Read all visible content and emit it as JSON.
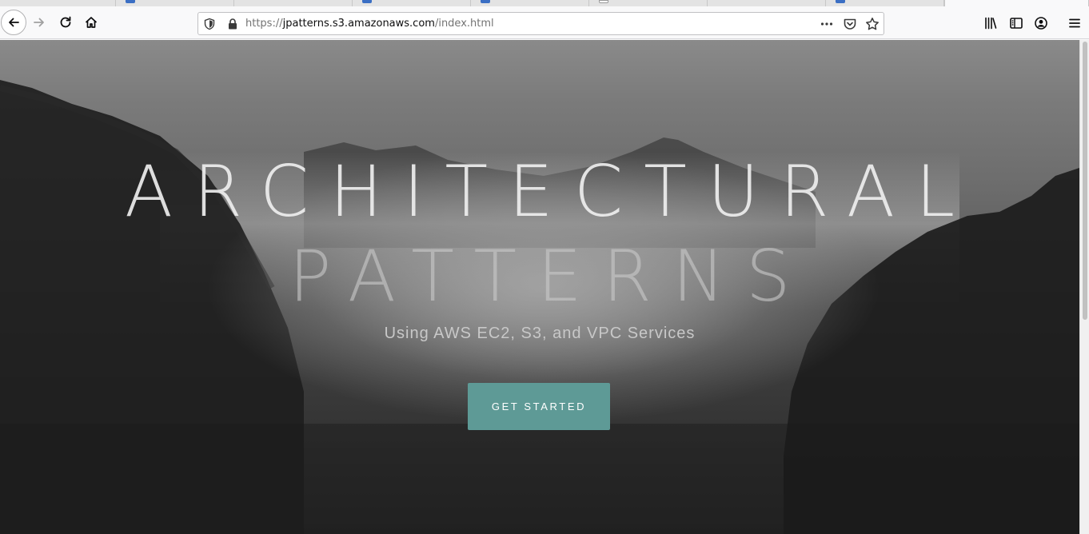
{
  "browser": {
    "tabs": [
      {
        "label": "",
        "active": false
      },
      {
        "label": "",
        "active": false
      },
      {
        "label": "",
        "active": false
      },
      {
        "label": "",
        "active": false
      },
      {
        "label": "",
        "active": false
      },
      {
        "label": "",
        "active": false
      },
      {
        "label": "",
        "active": false
      },
      {
        "label": "",
        "active": true
      }
    ],
    "address": {
      "protocol": "https://",
      "host": "jpatterns.s3.amazonaws.com",
      "path": "/index.html"
    },
    "icons": {
      "back": "back-arrow-icon",
      "forward": "forward-arrow-icon",
      "reload": "reload-icon",
      "home": "home-icon",
      "tracking": "shield-icon",
      "lock": "lock-icon",
      "page_actions": "ellipsis-icon",
      "pocket": "pocket-icon",
      "bookmark": "star-icon",
      "library": "library-icon",
      "sidebar": "sidebar-icon",
      "account": "account-icon",
      "menu": "hamburger-menu-icon"
    }
  },
  "hero": {
    "title_line1": "ARCHITECTURAL",
    "title_line2": "PATTERNS",
    "subtitle": "Using AWS EC2, S3, and VPC Services",
    "cta_label": "GET STARTED"
  },
  "colors": {
    "cta_background": "#5e9a96",
    "cta_text": "#ffffff",
    "title_text": "#eeeeee",
    "subtitle_text": "#c8c8c8"
  }
}
